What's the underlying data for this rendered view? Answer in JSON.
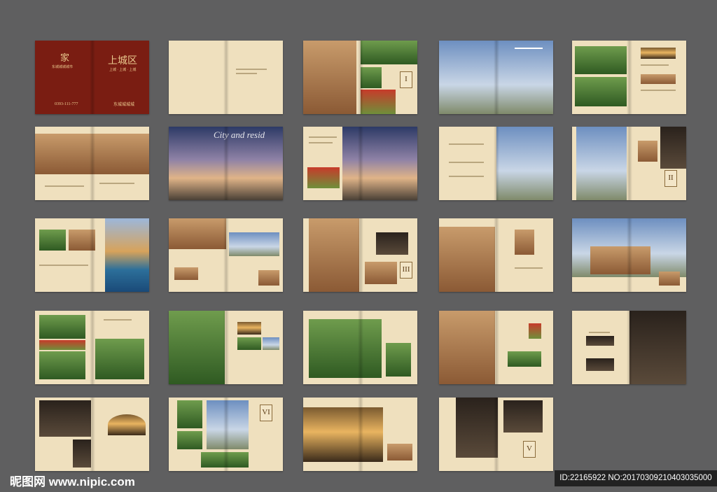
{
  "cover": {
    "left_title": "家",
    "left_sub": "东城城城城市",
    "phone": "0393-111-777",
    "right_title": "上城区",
    "right_sub": "上城 · 上城 · 上城",
    "brand": "东城城城城"
  },
  "roman_numerals": {
    "s1_3": "I",
    "s2_5": "II",
    "s3_3": "III",
    "s5_2": "VI",
    "s5_4": "V"
  },
  "overlay_texts": {
    "s2_2": "City and resid"
  },
  "footer": {
    "logo": "昵图网 www.nipic.com",
    "id_text": "ID:22165922 NO:20170309210403035000"
  }
}
